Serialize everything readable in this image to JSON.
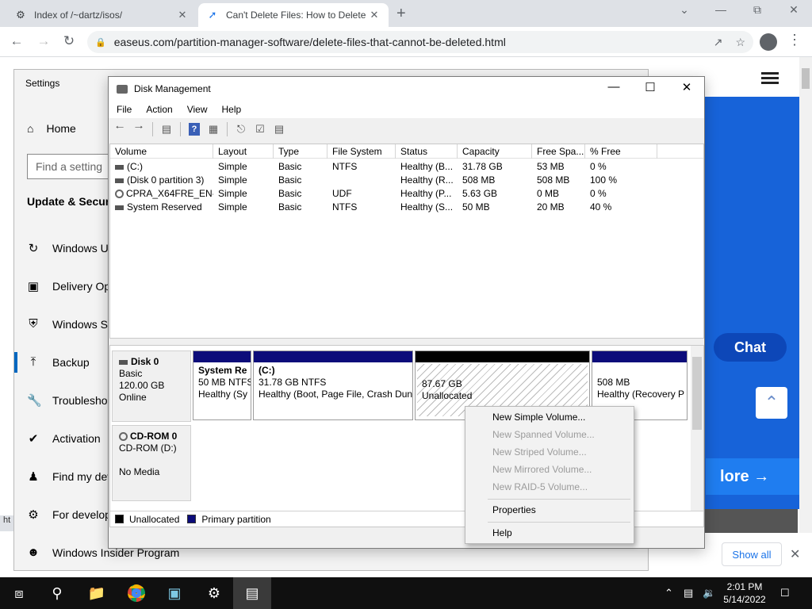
{
  "browser": {
    "tabs": [
      {
        "title": "Index of /~dartz/isos/",
        "icon": "archive-icon"
      },
      {
        "title": "Can't Delete Files: How to Delete",
        "icon": "easeus-icon"
      }
    ],
    "url": "easeus.com/partition-manager-software/delete-files-that-cannot-be-deleted.html",
    "status_url_hint": "ht"
  },
  "webpage": {
    "chat_label": "Chat",
    "more_label": "lore",
    "show_all_label": "Show all",
    "colors": {
      "banner": "#1763d9",
      "more_button": "#1f7df0"
    }
  },
  "settings": {
    "title": "Settings",
    "home_label": "Home",
    "search_placeholder": "Find a setting",
    "category": "Update & Securi",
    "nav": [
      {
        "label": "Windows U",
        "icon": "refresh-icon"
      },
      {
        "label": "Delivery Op",
        "icon": "delivery-icon"
      },
      {
        "label": "Windows Se",
        "icon": "shield-icon"
      },
      {
        "label": "Backup",
        "icon": "backup-arrow-icon"
      },
      {
        "label": "Troublesho",
        "icon": "wrench-icon"
      },
      {
        "label": "Activation",
        "icon": "check-circle-icon"
      },
      {
        "label": "Find my dev",
        "icon": "person-pin-icon"
      },
      {
        "label": "For develop",
        "icon": "developer-icon"
      },
      {
        "label": "Windows Insider Program",
        "icon": "insider-cat-icon"
      }
    ]
  },
  "disk_management": {
    "title": "Disk Management",
    "menu": [
      "File",
      "Action",
      "View",
      "Help"
    ],
    "columns": [
      "Volume",
      "Layout",
      "Type",
      "File System",
      "Status",
      "Capacity",
      "Free Spa...",
      "% Free"
    ],
    "volumes": [
      {
        "volume": "(C:)",
        "layout": "Simple",
        "type": "Basic",
        "fs": "NTFS",
        "status": "Healthy (B...",
        "capacity": "31.78 GB",
        "free": "53 MB",
        "pct": "0 %",
        "icon": "drive-icon"
      },
      {
        "volume": "(Disk 0 partition 3)",
        "layout": "Simple",
        "type": "Basic",
        "fs": "",
        "status": "Healthy (R...",
        "capacity": "508 MB",
        "free": "508 MB",
        "pct": "100 %",
        "icon": "drive-icon"
      },
      {
        "volume": "CPRA_X64FRE_EN-...",
        "layout": "Simple",
        "type": "Basic",
        "fs": "UDF",
        "status": "Healthy (P...",
        "capacity": "5.63 GB",
        "free": "0 MB",
        "pct": "0 %",
        "icon": "cd-icon"
      },
      {
        "volume": "System Reserved",
        "layout": "Simple",
        "type": "Basic",
        "fs": "NTFS",
        "status": "Healthy (S...",
        "capacity": "50 MB",
        "free": "20 MB",
        "pct": "40 %",
        "icon": "drive-icon"
      }
    ],
    "disks": [
      {
        "name": "Disk 0",
        "type": "Basic",
        "size": "120.00 GB",
        "state": "Online"
      },
      {
        "name": "CD-ROM 0",
        "type": "CD-ROM (D:)",
        "size": "",
        "state": "No Media"
      }
    ],
    "partitions": [
      {
        "name": "System Re",
        "line1": "50 MB NTFS",
        "line2": "Healthy (Sy"
      },
      {
        "name": "(C:)",
        "line1": "31.78 GB NTFS",
        "line2": "Healthy (Boot, Page File, Crash Dun"
      },
      {
        "name": "",
        "line1": "87.67 GB",
        "line2": "Unallocated"
      },
      {
        "name": "",
        "line1": "508 MB",
        "line2": "Healthy (Recovery P"
      }
    ],
    "legend": [
      {
        "label": "Unallocated",
        "color": "#000000"
      },
      {
        "label": "Primary partition",
        "color": "#0c0c7a"
      }
    ],
    "context_menu": [
      {
        "label": "New Simple Volume...",
        "enabled": true
      },
      {
        "label": "New Spanned Volume...",
        "enabled": false
      },
      {
        "label": "New Striped Volume...",
        "enabled": false
      },
      {
        "label": "New Mirrored Volume...",
        "enabled": false
      },
      {
        "label": "New RAID-5 Volume...",
        "enabled": false
      },
      {
        "label": "Properties",
        "enabled": true
      },
      {
        "label": "Help",
        "enabled": true
      }
    ]
  },
  "taskbar": {
    "time": "2:01 PM",
    "date": "5/14/2022",
    "apps": [
      "windows-start-icon",
      "search-icon",
      "file-explorer-icon",
      "chrome-icon",
      "control-panel-icon",
      "settings-gear-icon",
      "disk-management-icon"
    ]
  }
}
